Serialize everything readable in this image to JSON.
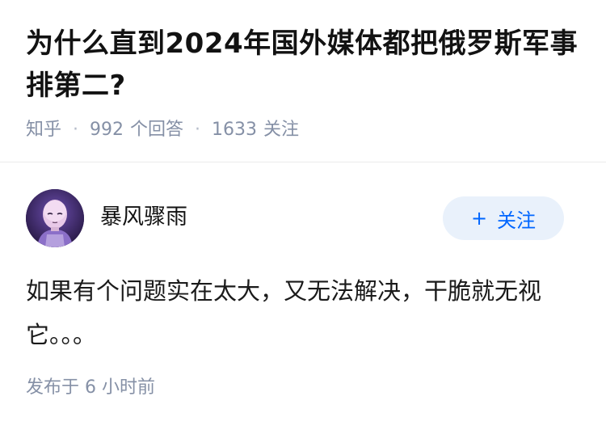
{
  "question": {
    "title": "为什么直到2024年国外媒体都把俄罗斯军事排第二?",
    "source": "知乎",
    "answer_count": "992",
    "answer_label": "个回答",
    "follower_count": "1633",
    "follower_label": "关注"
  },
  "answer": {
    "author_name": "暴风骤雨",
    "follow_button_label": "关注",
    "content": "如果有个问题实在太大，又无法解决，干脆就无视它。。。",
    "published_time": "发布于  6 小时前"
  },
  "colors": {
    "title": "#121212",
    "meta": "#8590a6",
    "accent": "#0066ff",
    "follow_bg": "#e9f1fb"
  },
  "icons": {
    "avatar": "bald-hero-avatar-icon",
    "follow": "plus-icon"
  }
}
